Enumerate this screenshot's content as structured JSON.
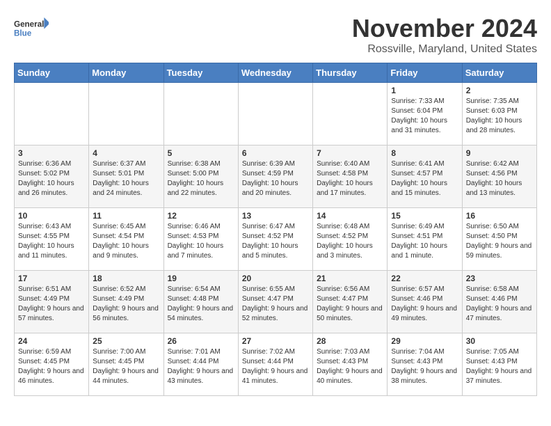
{
  "logo": {
    "general": "General",
    "blue": "Blue"
  },
  "title": "November 2024",
  "subtitle": "Rossville, Maryland, United States",
  "weekdays": [
    "Sunday",
    "Monday",
    "Tuesday",
    "Wednesday",
    "Thursday",
    "Friday",
    "Saturday"
  ],
  "weeks": [
    [
      {
        "day": "",
        "info": ""
      },
      {
        "day": "",
        "info": ""
      },
      {
        "day": "",
        "info": ""
      },
      {
        "day": "",
        "info": ""
      },
      {
        "day": "",
        "info": ""
      },
      {
        "day": "1",
        "info": "Sunrise: 7:33 AM\nSunset: 6:04 PM\nDaylight: 10 hours and 31 minutes."
      },
      {
        "day": "2",
        "info": "Sunrise: 7:35 AM\nSunset: 6:03 PM\nDaylight: 10 hours and 28 minutes."
      }
    ],
    [
      {
        "day": "3",
        "info": "Sunrise: 6:36 AM\nSunset: 5:02 PM\nDaylight: 10 hours and 26 minutes."
      },
      {
        "day": "4",
        "info": "Sunrise: 6:37 AM\nSunset: 5:01 PM\nDaylight: 10 hours and 24 minutes."
      },
      {
        "day": "5",
        "info": "Sunrise: 6:38 AM\nSunset: 5:00 PM\nDaylight: 10 hours and 22 minutes."
      },
      {
        "day": "6",
        "info": "Sunrise: 6:39 AM\nSunset: 4:59 PM\nDaylight: 10 hours and 20 minutes."
      },
      {
        "day": "7",
        "info": "Sunrise: 6:40 AM\nSunset: 4:58 PM\nDaylight: 10 hours and 17 minutes."
      },
      {
        "day": "8",
        "info": "Sunrise: 6:41 AM\nSunset: 4:57 PM\nDaylight: 10 hours and 15 minutes."
      },
      {
        "day": "9",
        "info": "Sunrise: 6:42 AM\nSunset: 4:56 PM\nDaylight: 10 hours and 13 minutes."
      }
    ],
    [
      {
        "day": "10",
        "info": "Sunrise: 6:43 AM\nSunset: 4:55 PM\nDaylight: 10 hours and 11 minutes."
      },
      {
        "day": "11",
        "info": "Sunrise: 6:45 AM\nSunset: 4:54 PM\nDaylight: 10 hours and 9 minutes."
      },
      {
        "day": "12",
        "info": "Sunrise: 6:46 AM\nSunset: 4:53 PM\nDaylight: 10 hours and 7 minutes."
      },
      {
        "day": "13",
        "info": "Sunrise: 6:47 AM\nSunset: 4:52 PM\nDaylight: 10 hours and 5 minutes."
      },
      {
        "day": "14",
        "info": "Sunrise: 6:48 AM\nSunset: 4:52 PM\nDaylight: 10 hours and 3 minutes."
      },
      {
        "day": "15",
        "info": "Sunrise: 6:49 AM\nSunset: 4:51 PM\nDaylight: 10 hours and 1 minute."
      },
      {
        "day": "16",
        "info": "Sunrise: 6:50 AM\nSunset: 4:50 PM\nDaylight: 9 hours and 59 minutes."
      }
    ],
    [
      {
        "day": "17",
        "info": "Sunrise: 6:51 AM\nSunset: 4:49 PM\nDaylight: 9 hours and 57 minutes."
      },
      {
        "day": "18",
        "info": "Sunrise: 6:52 AM\nSunset: 4:49 PM\nDaylight: 9 hours and 56 minutes."
      },
      {
        "day": "19",
        "info": "Sunrise: 6:54 AM\nSunset: 4:48 PM\nDaylight: 9 hours and 54 minutes."
      },
      {
        "day": "20",
        "info": "Sunrise: 6:55 AM\nSunset: 4:47 PM\nDaylight: 9 hours and 52 minutes."
      },
      {
        "day": "21",
        "info": "Sunrise: 6:56 AM\nSunset: 4:47 PM\nDaylight: 9 hours and 50 minutes."
      },
      {
        "day": "22",
        "info": "Sunrise: 6:57 AM\nSunset: 4:46 PM\nDaylight: 9 hours and 49 minutes."
      },
      {
        "day": "23",
        "info": "Sunrise: 6:58 AM\nSunset: 4:46 PM\nDaylight: 9 hours and 47 minutes."
      }
    ],
    [
      {
        "day": "24",
        "info": "Sunrise: 6:59 AM\nSunset: 4:45 PM\nDaylight: 9 hours and 46 minutes."
      },
      {
        "day": "25",
        "info": "Sunrise: 7:00 AM\nSunset: 4:45 PM\nDaylight: 9 hours and 44 minutes."
      },
      {
        "day": "26",
        "info": "Sunrise: 7:01 AM\nSunset: 4:44 PM\nDaylight: 9 hours and 43 minutes."
      },
      {
        "day": "27",
        "info": "Sunrise: 7:02 AM\nSunset: 4:44 PM\nDaylight: 9 hours and 41 minutes."
      },
      {
        "day": "28",
        "info": "Sunrise: 7:03 AM\nSunset: 4:43 PM\nDaylight: 9 hours and 40 minutes."
      },
      {
        "day": "29",
        "info": "Sunrise: 7:04 AM\nSunset: 4:43 PM\nDaylight: 9 hours and 38 minutes."
      },
      {
        "day": "30",
        "info": "Sunrise: 7:05 AM\nSunset: 4:43 PM\nDaylight: 9 hours and 37 minutes."
      }
    ]
  ]
}
